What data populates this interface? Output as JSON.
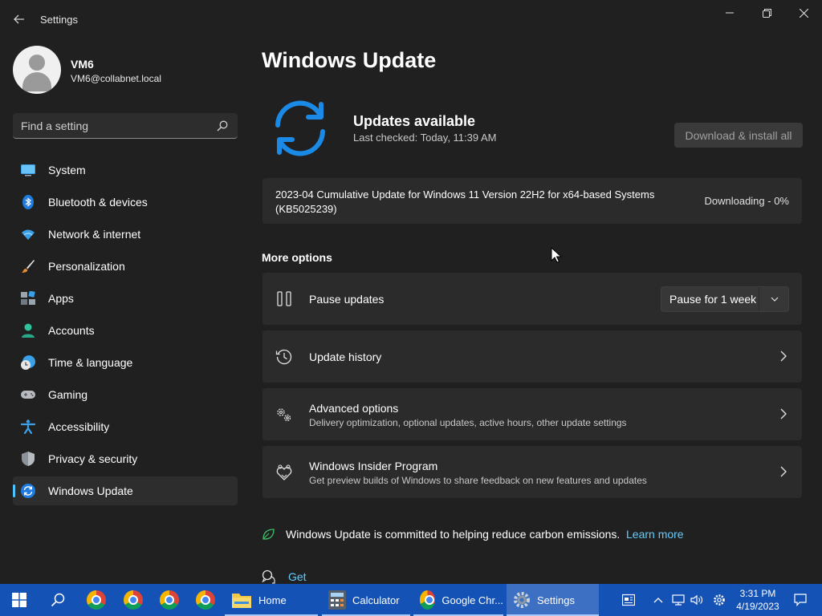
{
  "window": {
    "title": "Settings"
  },
  "profile": {
    "name": "VM6",
    "email": "VM6@collabnet.local"
  },
  "search": {
    "placeholder": "Find a setting"
  },
  "sidebar": {
    "items": [
      {
        "label": "System",
        "icon": "monitor-icon"
      },
      {
        "label": "Bluetooth & devices",
        "icon": "bluetooth-icon"
      },
      {
        "label": "Network & internet",
        "icon": "wifi-icon"
      },
      {
        "label": "Personalization",
        "icon": "brush-icon"
      },
      {
        "label": "Apps",
        "icon": "apps-icon"
      },
      {
        "label": "Accounts",
        "icon": "person-icon"
      },
      {
        "label": "Time & language",
        "icon": "clock-globe-icon"
      },
      {
        "label": "Gaming",
        "icon": "gamepad-icon"
      },
      {
        "label": "Accessibility",
        "icon": "accessibility-icon"
      },
      {
        "label": "Privacy & security",
        "icon": "shield-icon"
      },
      {
        "label": "Windows Update",
        "icon": "sync-icon",
        "active": true
      }
    ]
  },
  "main": {
    "title": "Windows Update",
    "status": {
      "title": "Updates available",
      "last_checked": "Last checked: Today, 11:39 AM",
      "button": "Download & install all"
    },
    "update": {
      "name": "2023-04 Cumulative Update for Windows 11 Version 22H2 for x64-based Systems (KB5025239)",
      "progress": "Downloading - 0%"
    },
    "more_options_title": "More options",
    "options": {
      "pause": {
        "label": "Pause updates",
        "select_value": "Pause for 1 week"
      },
      "history": {
        "label": "Update history"
      },
      "advanced": {
        "label": "Advanced options",
        "desc": "Delivery optimization, optional updates, active hours, other update settings"
      },
      "insider": {
        "label": "Windows Insider Program",
        "desc": "Get preview builds of Windows to share feedback on new features and updates"
      }
    },
    "carbon": {
      "text": "Windows Update is committed to helping reduce carbon emissions.",
      "link": "Learn more"
    },
    "help": {
      "text": "Get help"
    }
  },
  "taskbar": {
    "apps": [
      {
        "label": "Home"
      },
      {
        "label": "Calculator"
      },
      {
        "label": "Google Chr..."
      },
      {
        "label": "Settings"
      }
    ],
    "clock": {
      "time": "3:31 PM",
      "date": "4/19/2023"
    }
  },
  "colors": {
    "accent": "#4cc2ff",
    "link": "#60cdff",
    "background": "#202020",
    "card": "#2b2b2b",
    "taskbar": "#1452b5"
  }
}
